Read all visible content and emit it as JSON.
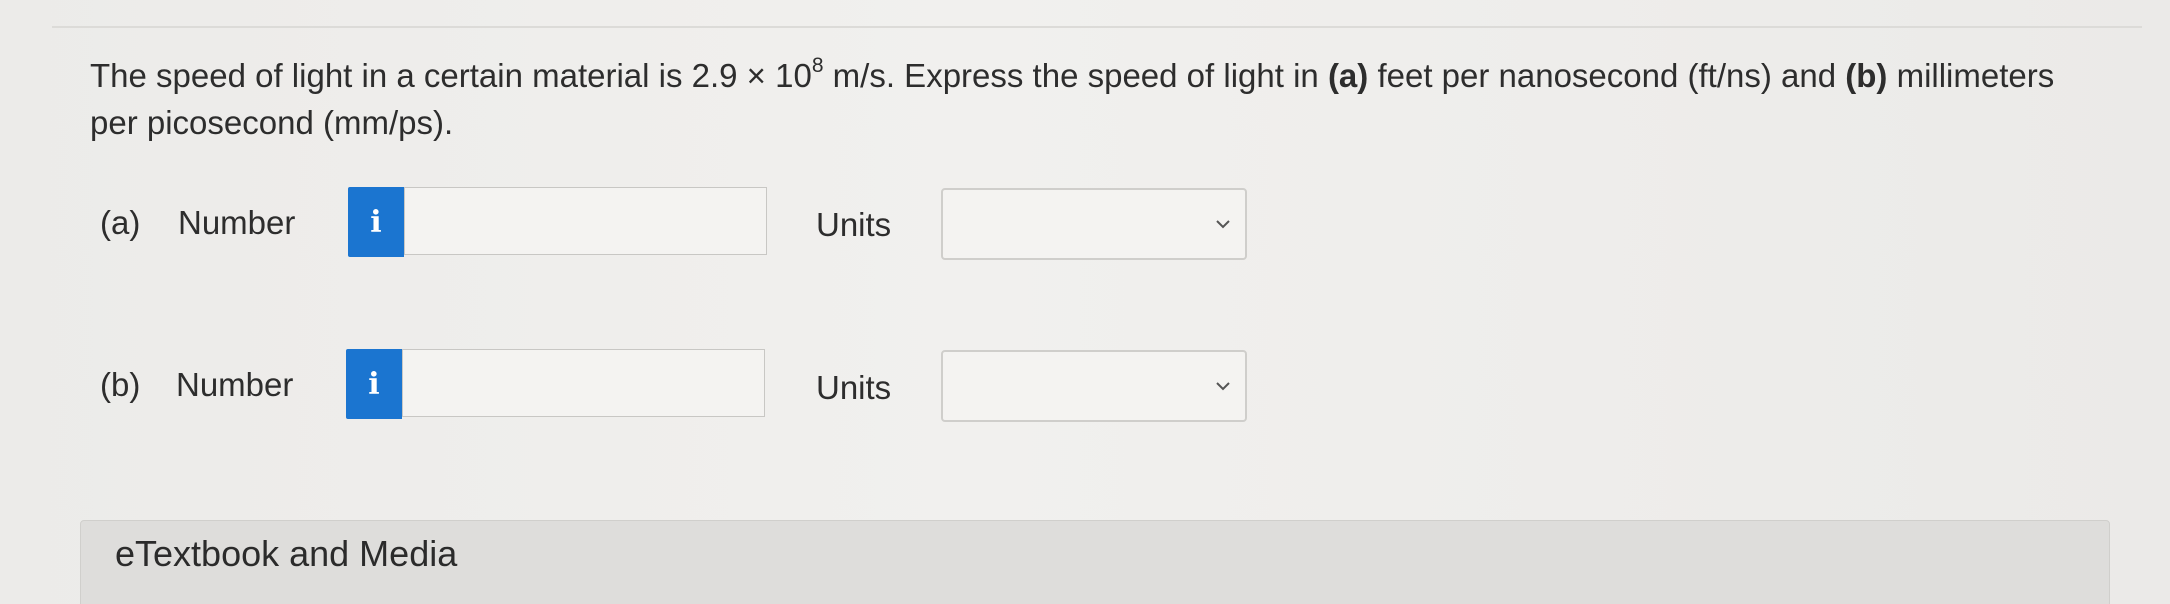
{
  "question": {
    "text_1": "The speed of light in a certain material is 2.9 × 10",
    "exponent": "8",
    "text_2": " m/s. Express the speed of light in ",
    "part_a_marker": "(a)",
    "text_3": " feet per nanosecond (ft/ns) and ",
    "part_b_marker": "(b)",
    "text_4": " millimeters per picosecond (mm/ps)."
  },
  "parts": [
    {
      "label": "(a)",
      "number_label": "Number",
      "info_icon": "i",
      "number_value": "",
      "units_label": "Units",
      "units_value": ""
    },
    {
      "label": "(b)",
      "number_label": "Number",
      "info_icon": "i",
      "number_value": "",
      "units_label": "Units",
      "units_value": ""
    }
  ],
  "media": {
    "label": "eTextbook and Media"
  },
  "colors": {
    "info_button": "#1b75d0",
    "background": "#eeedeb"
  }
}
